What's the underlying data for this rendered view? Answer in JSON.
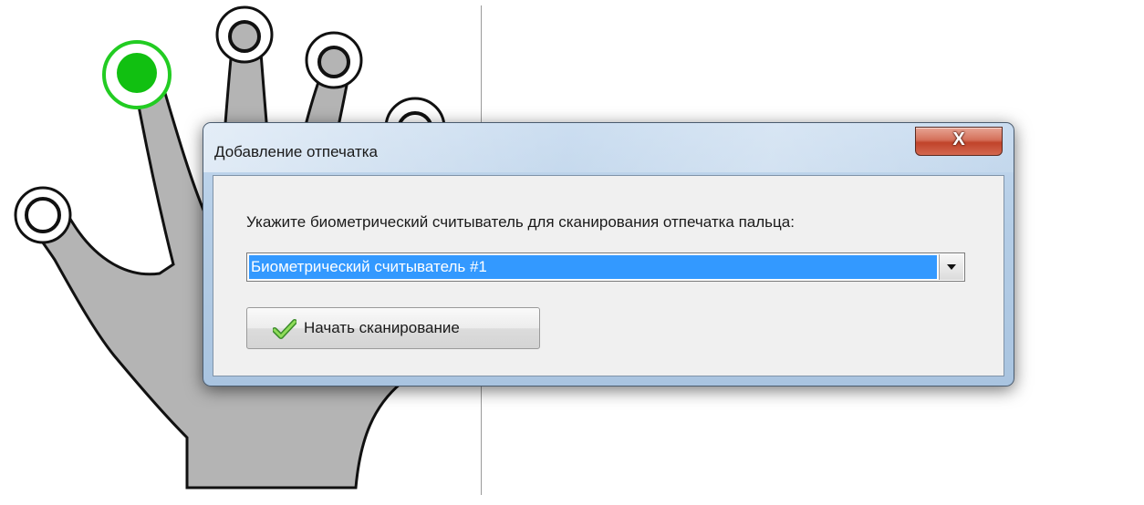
{
  "dialog": {
    "title": "Добавление отпечатка",
    "prompt": "Укажите биометрический считыватель для сканирования отпечатка пальца:",
    "reader_select": {
      "selected": "Биометрический считыватель #1"
    },
    "scan_button_label": "Начать сканирование",
    "close_label": "X"
  },
  "colors": {
    "selected_finger": "#22cc22",
    "finger_marker": "#111111",
    "hand_fill": "#b4b4b4",
    "selection_highlight": "#3399ff"
  },
  "hand": {
    "fingers": [
      "little",
      "ring",
      "middle",
      "index",
      "thumb"
    ],
    "selected_finger": "thumb"
  },
  "icons": {
    "scan_button_icon": "checkmark-icon",
    "close_icon": "close-icon"
  }
}
